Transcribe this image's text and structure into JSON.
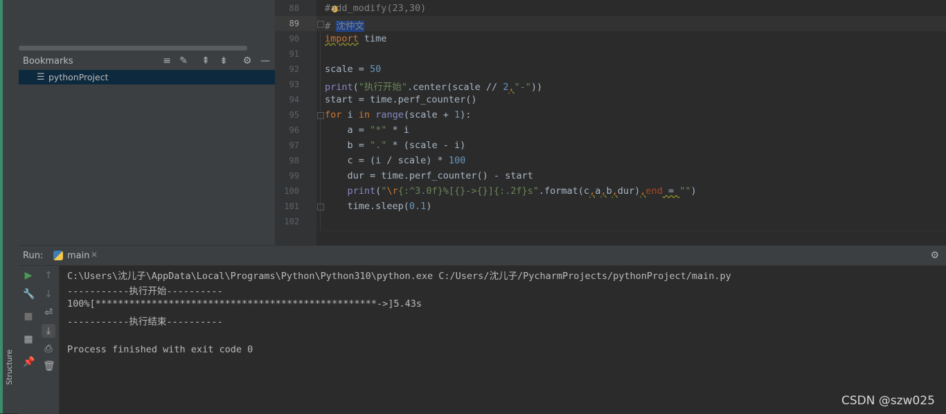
{
  "left_strip": {
    "structure_label": "Structure"
  },
  "bookmarks": {
    "title": "Bookmarks",
    "items": [
      {
        "label": "pythonProject"
      }
    ]
  },
  "editor": {
    "line_numbers": [
      "88",
      "89",
      "90",
      "91",
      "92",
      "93",
      "94",
      "95",
      "96",
      "97",
      "98",
      "99",
      "100",
      "101",
      "102"
    ],
    "lines": {
      "l88_hash": "#",
      "l88_rest": "add_modify(23,30)",
      "l89_hash": "# ",
      "l89_sel": "沈仲文",
      "l90_kw": "import",
      "l90_rest": " time",
      "l92_a": "scale = ",
      "l92_num": "50",
      "l93_fn": "print",
      "l93_p": "(",
      "l93_str": "\"执行开始\"",
      "l93_mid": ".center(scale // ",
      "l93_num": "2",
      "l93_comma": ",",
      "l93_str2": "\"-\"",
      "l93_end": "))",
      "l94": "start = time.perf_counter()",
      "l95_for": "for",
      "l95_i": " i ",
      "l95_in": "in",
      "l95_sp": " ",
      "l95_range": "range",
      "l95_rest": "(scale + ",
      "l95_num": "1",
      "l95_end": "):",
      "l96_a": "    a = ",
      "l96_str": "\"*\"",
      "l96_rest": " * i",
      "l97_a": "    b = ",
      "l97_str": "\".\"",
      "l97_rest": " * (scale - i)",
      "l98_a": "    c = (i / scale) * ",
      "l98_num": "100",
      "l99": "    dur = time.perf_counter() - start",
      "l100_ind": "    ",
      "l100_fn": "print",
      "l100_p": "(",
      "l100_q": "\"",
      "l100_esc": "\\r",
      "l100_str": "{:^3.0f}%[{}->{}]{:.2f}s\"",
      "l100_mid1": ".format(c",
      "l100_c1": ",",
      "l100_a": "a",
      "l100_c2": ",",
      "l100_b": "b",
      "l100_c3": ",",
      "l100_dur": "dur)",
      "l100_c4": ",",
      "l100_end": "end",
      "l100_eq": " = ",
      "l100_str2": "\"\"",
      "l100_close": ")",
      "l101_a": "    time.sleep(",
      "l101_num": "0.1",
      "l101_end": ")"
    }
  },
  "run": {
    "label": "Run:",
    "tab_label": "main",
    "console": [
      "C:\\Users\\沈儿子\\AppData\\Local\\Programs\\Python\\Python310\\python.exe C:/Users/沈儿子/PycharmProjects/pythonProject/main.py",
      "-----------执行开始----------",
      "100%[**************************************************->]5.43s",
      "-----------执行结束----------",
      "",
      "Process finished with exit code 0"
    ]
  },
  "watermark": "CSDN @szw025",
  "colors": {
    "keyword": "#cc7832",
    "string": "#6a8759",
    "number": "#6897bb",
    "builtin": "#8888c6",
    "selection": "#214283",
    "panel_bg": "#3c3f41",
    "editor_bg": "#2b2b2b"
  }
}
